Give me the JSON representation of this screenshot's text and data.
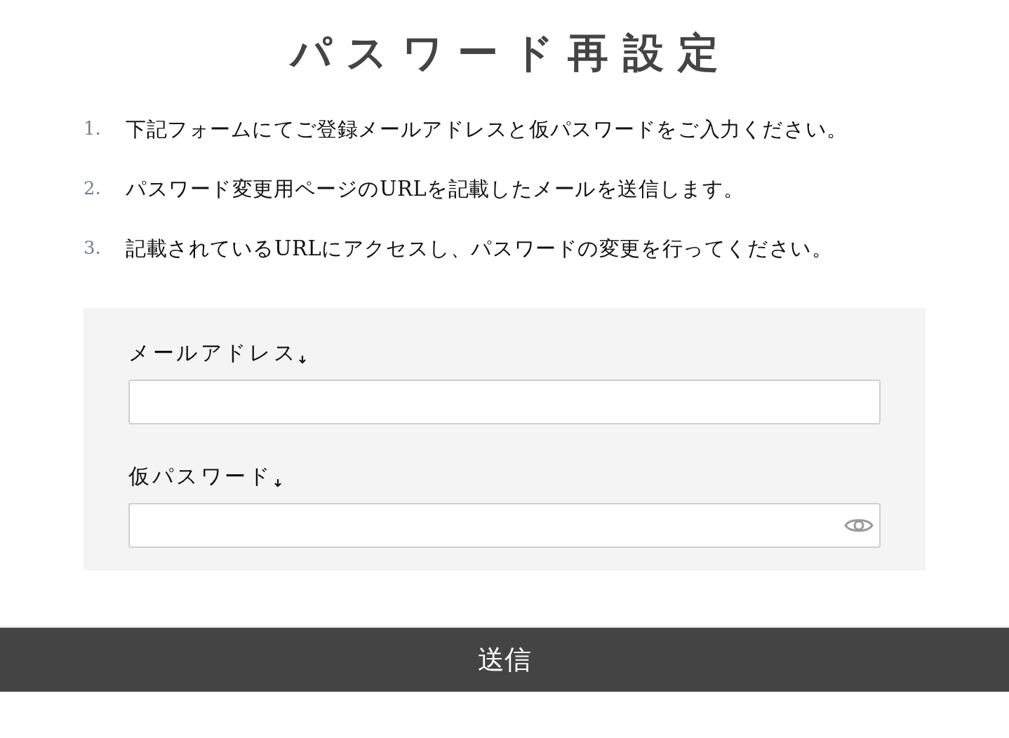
{
  "title": "パスワード再設定",
  "steps": [
    {
      "number": "1.",
      "text": "下記フォームにてご登録メールアドレスと仮パスワードをご入力ください。"
    },
    {
      "number": "2.",
      "text": "パスワード変更用ページのURLを記載したメールを送信します。"
    },
    {
      "number": "3.",
      "text": "記載されているURLにアクセスし、パスワードの変更を行ってください。"
    }
  ],
  "fields": [
    {
      "label": "メールアドレス",
      "kind": "email",
      "required": true
    },
    {
      "label": "仮パスワード",
      "kind": "password",
      "required": true
    }
  ],
  "submit_button": "送信"
}
